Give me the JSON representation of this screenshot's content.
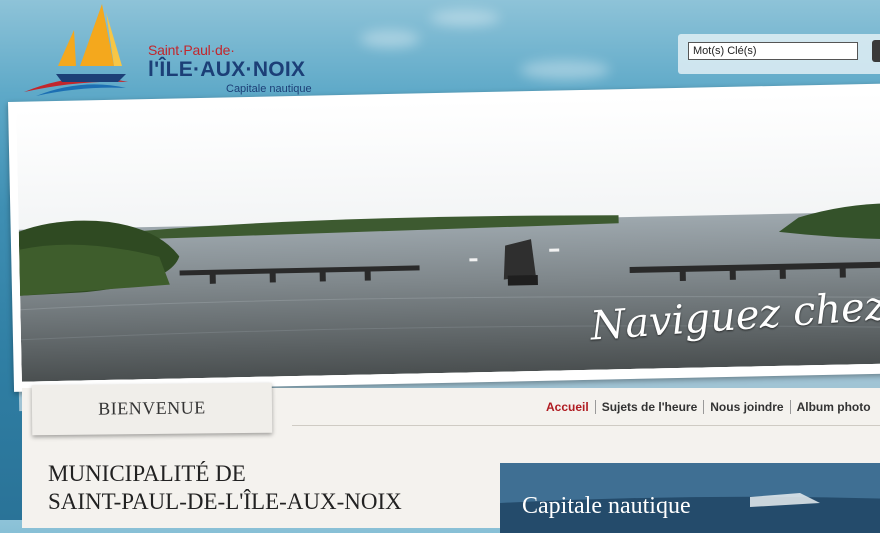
{
  "header": {
    "logo_small": "Saint·Paul·de·",
    "logo_main": "l'ÎLE·AUX·NOIX",
    "logo_tagline": "Capitale nautique"
  },
  "search": {
    "value": "Mot(s) Clé(s)"
  },
  "banner": {
    "title": "Naviguez chez n"
  },
  "tab": {
    "label": "BIENVENUE"
  },
  "nav": {
    "items": [
      {
        "label": "Accueil",
        "active": true
      },
      {
        "label": "Sujets de l'heure",
        "active": false
      },
      {
        "label": "Nous joindre",
        "active": false
      },
      {
        "label": "Album photo",
        "active": false
      }
    ]
  },
  "main": {
    "title_line1": "MUNICIPALITÉ DE",
    "title_line2": "SAINT-PAUL-DE-L'ÎLE-AUX-NOIX"
  },
  "feature": {
    "label": "Capitale nautique"
  },
  "colors": {
    "brand_blue": "#1c3f77",
    "brand_red": "#c2262c",
    "nav_active": "#b01c22"
  }
}
